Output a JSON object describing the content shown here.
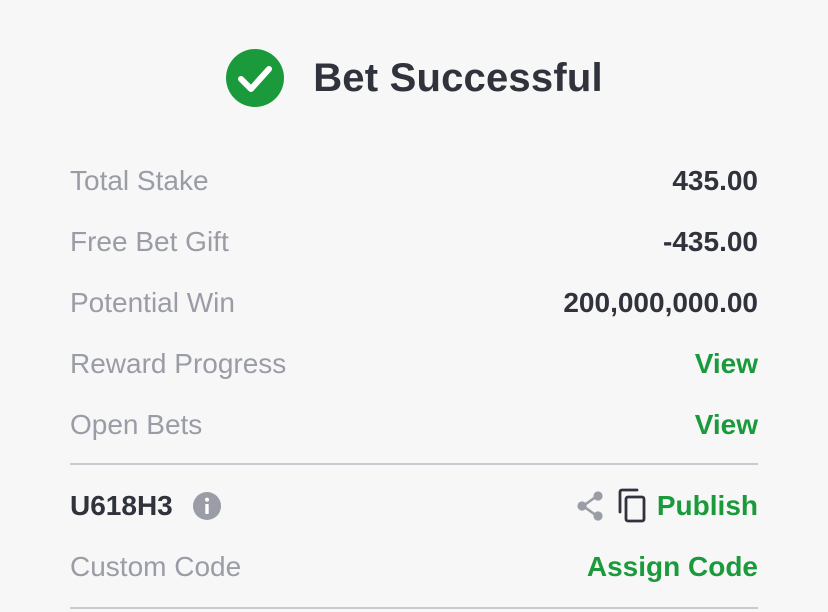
{
  "header": {
    "title": "Bet Successful",
    "icon": "check-circle-icon"
  },
  "summary": [
    {
      "label": "Total Stake",
      "value": "435.00",
      "kind": "value"
    },
    {
      "label": "Free Bet Gift",
      "value": "-435.00",
      "kind": "value"
    },
    {
      "label": "Potential Win",
      "value": "200,000,000.00",
      "kind": "value"
    },
    {
      "label": "Reward Progress",
      "value": "View",
      "kind": "link"
    },
    {
      "label": "Open Bets",
      "value": "View",
      "kind": "link"
    }
  ],
  "booking": {
    "code": "U618H3",
    "publish_label": "Publish",
    "custom_code_label": "Custom Code",
    "assign_code_label": "Assign Code"
  },
  "colors": {
    "accent_green": "#1b9a3c",
    "text_dark": "#30323c",
    "text_muted": "#9a9ca6",
    "background": "#f7f7f8",
    "divider": "#c9cad0"
  }
}
